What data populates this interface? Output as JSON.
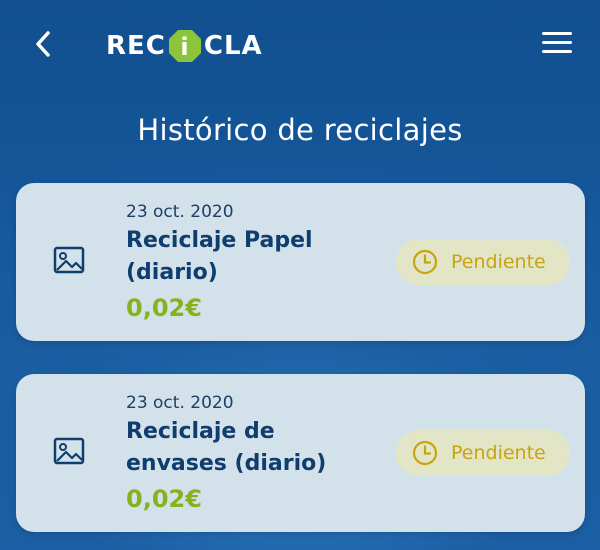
{
  "header": {
    "back_icon": "chevron-left-icon",
    "logo_text_left": "REC",
    "logo_mark_letter": "i",
    "logo_text_right": "CLA",
    "menu_icon": "hamburger-menu-icon"
  },
  "page": {
    "title": "Histórico de reciclajes"
  },
  "records": [
    {
      "date": "23 oct. 2020",
      "name": "Reciclaje Papel (diario)",
      "amount": "0,02€",
      "status": "Pendiente",
      "thumb_icon": "image-placeholder-icon",
      "status_icon": "clock-icon"
    },
    {
      "date": "23 oct. 2020",
      "name": "Reciclaje de envases (diario)",
      "amount": "0,02€",
      "status": "Pendiente",
      "thumb_icon": "image-placeholder-icon",
      "status_icon": "clock-icon"
    }
  ],
  "colors": {
    "background": "#15589b",
    "card": "#d3e1ea",
    "title_text": "#0f3d6e",
    "amount": "#86b21d",
    "status_bg": "#e2e6c7",
    "status_text": "#c8a30f",
    "logo_mark": "#8cc43a"
  }
}
